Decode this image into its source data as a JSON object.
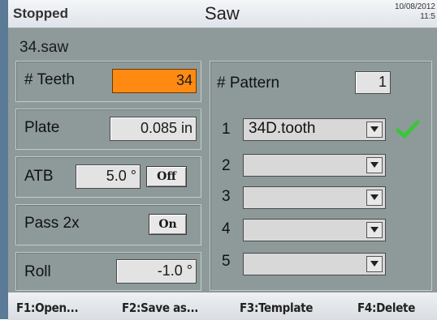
{
  "header": {
    "status": "Stopped",
    "title": "Saw",
    "date": "10/08/2012",
    "time": "11:5"
  },
  "file": {
    "name": "34.saw"
  },
  "teeth": {
    "label": "# Teeth",
    "value": "34"
  },
  "plate": {
    "label": "Plate",
    "value": "0.085 in"
  },
  "atb": {
    "label": "ATB",
    "value": "5.0 °",
    "toggle": "Off"
  },
  "pass2x": {
    "label": "Pass 2x",
    "toggle": "On"
  },
  "roll": {
    "label": "Roll",
    "value": "-1.0 °"
  },
  "pattern": {
    "label": "# Pattern",
    "count": "1",
    "rows": [
      {
        "num": "1",
        "value": "34D.tooth",
        "checked": true
      },
      {
        "num": "2",
        "value": ""
      },
      {
        "num": "3",
        "value": ""
      },
      {
        "num": "4",
        "value": ""
      },
      {
        "num": "5",
        "value": ""
      }
    ]
  },
  "footer": {
    "f1": "F1:Open...",
    "f2": "F2:Save as...",
    "f3": "F3:Template",
    "f4": "F4:Delete"
  },
  "colors": {
    "active_field": "#ff8a12",
    "panel": "#8e9a9a",
    "check": "#3cc43c"
  }
}
